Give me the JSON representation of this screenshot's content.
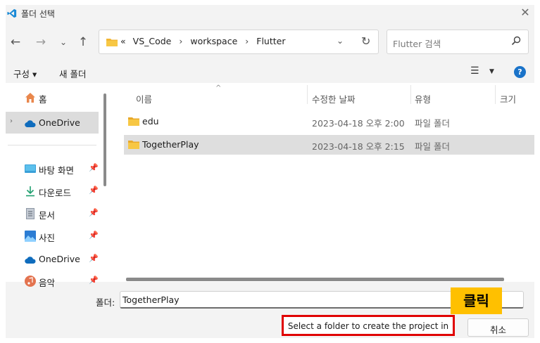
{
  "window": {
    "title": "폴더 선택",
    "close_icon": "close-icon",
    "app_icon": "vscode-icon"
  },
  "nav": {
    "back_icon": "arrow-left-icon",
    "forward_icon": "arrow-right-icon",
    "recent_icon": "chevron-down-icon",
    "up_icon": "arrow-up-icon"
  },
  "address": {
    "overflow": "«",
    "crumbs": [
      "VS_Code",
      "workspace",
      "Flutter"
    ],
    "separator": "›"
  },
  "search": {
    "placeholder": "Flutter 검색"
  },
  "toolbar": {
    "organize_label": "구성 ▾",
    "new_folder_label": "새 폴더"
  },
  "sidebar": {
    "items": [
      {
        "label": "홈",
        "icon": "home-icon",
        "pinned": false
      },
      {
        "label": "OneDrive",
        "icon": "cloud-icon",
        "pinned": false,
        "selected": true,
        "expandable": true
      },
      {
        "label": "바탕 화면",
        "icon": "desktop-icon",
        "pinned": true
      },
      {
        "label": "다운로드",
        "icon": "download-icon",
        "pinned": true
      },
      {
        "label": "문서",
        "icon": "document-icon",
        "pinned": true
      },
      {
        "label": "사진",
        "icon": "picture-icon",
        "pinned": true
      },
      {
        "label": "OneDrive",
        "icon": "cloud-icon",
        "pinned": true
      },
      {
        "label": "음악",
        "icon": "music-icon",
        "pinned": true
      }
    ]
  },
  "columns": {
    "name": "이름",
    "modified": "수정한 날짜",
    "type": "유형",
    "size": "크기"
  },
  "files": [
    {
      "name": "edu",
      "modified": "2023-04-18 오후 2:00",
      "type": "파일 폴더",
      "selected": false
    },
    {
      "name": "TogetherPlay",
      "modified": "2023-04-18 오후 2:15",
      "type": "파일 폴더",
      "selected": true
    }
  ],
  "footer": {
    "folder_label": "폴더:",
    "folder_value": "TogetherPlay",
    "select_button": "Select a folder to create the project in",
    "cancel_button": "취소"
  },
  "annotation": {
    "label": "클릭"
  },
  "colors": {
    "folder": "#f7c744",
    "accent_blue": "#1a73c9",
    "highlight_red": "#e00000",
    "callout_yellow": "#ffc000"
  }
}
